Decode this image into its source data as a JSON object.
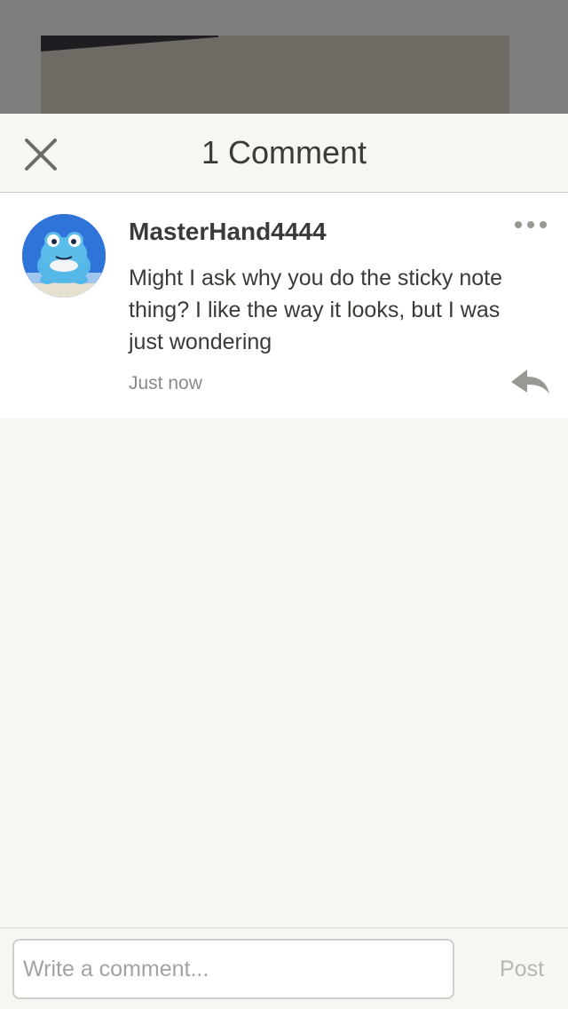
{
  "header": {
    "title": "1 Comment",
    "close_icon": "close-icon"
  },
  "comments": [
    {
      "username": "MasterHand4444",
      "text": "Might I ask why you do the sticky note thing? I like the way it looks, but I was just wondering",
      "timestamp": "Just now",
      "more_icon": "more-dots-icon",
      "reply_icon": "reply-arrow-icon"
    }
  ],
  "composer": {
    "placeholder": "Write a comment...",
    "value": "",
    "post_label": "Post"
  },
  "colors": {
    "background": "#f7f6f2",
    "text": "#3b3a37",
    "muted": "#8c8a86",
    "backdrop": "#7e7e7e"
  }
}
